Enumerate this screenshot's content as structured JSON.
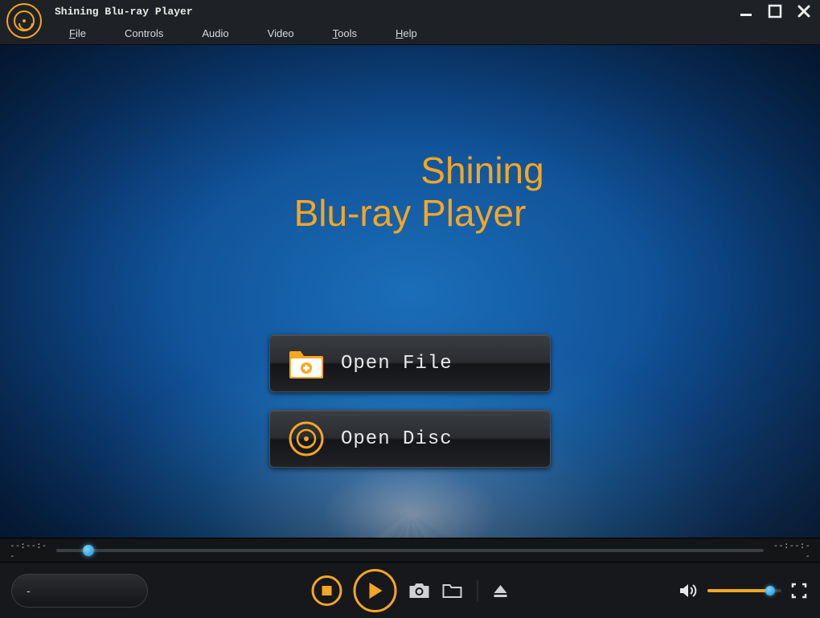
{
  "app": {
    "title": "Shining Blu-ray Player"
  },
  "menu": {
    "items": [
      {
        "underline": "F",
        "rest": "ile"
      },
      {
        "underline": "",
        "rest": "Controls"
      },
      {
        "underline": "",
        "rest": "Audio"
      },
      {
        "underline": "",
        "rest": "Video"
      },
      {
        "underline": "T",
        "rest": "ools"
      },
      {
        "underline": "H",
        "rest": "elp"
      }
    ]
  },
  "brand": {
    "line1": "Shining",
    "line2": "Blu-ray Player"
  },
  "buttons": {
    "open_file": "Open File",
    "open_disc": "Open Disc"
  },
  "progress": {
    "elapsed": "--:--:--",
    "remaining": "--:--:--"
  },
  "info": {
    "text": "-"
  },
  "colors": {
    "accent": "#f5a623"
  }
}
